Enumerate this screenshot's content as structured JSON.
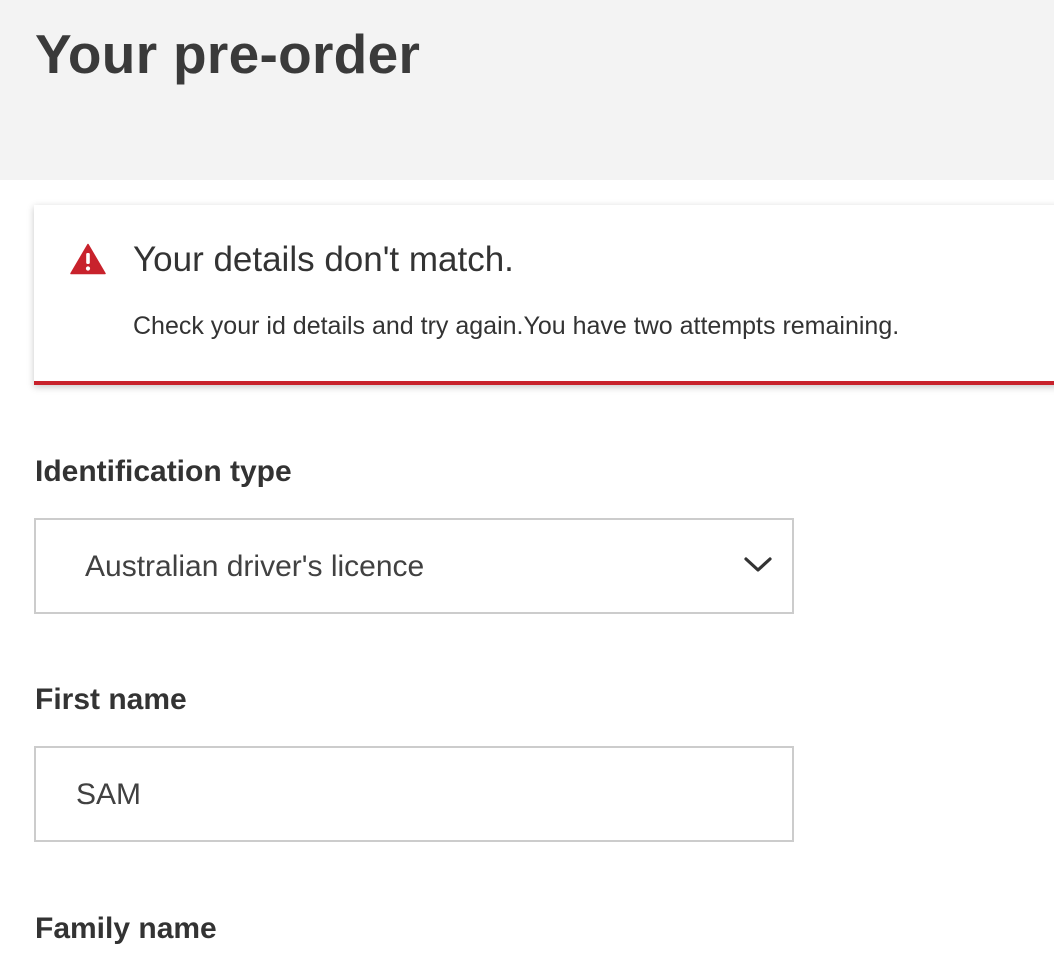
{
  "header": {
    "title": "Your pre-order"
  },
  "alert": {
    "icon": "warning-triangle-icon",
    "title": "Your details don't match.",
    "message": "Check your id details and try again.You have two attempts remaining.",
    "accent_color": "#c8222c"
  },
  "form": {
    "identification_type": {
      "label": "Identification type",
      "selected_value": "Australian driver's licence",
      "icon": "chevron-down-icon"
    },
    "first_name": {
      "label": "First name",
      "value": "SAM"
    },
    "family_name": {
      "label": "Family name"
    }
  },
  "colors": {
    "header_background": "#f3f3f3",
    "text": "#333333",
    "field_border": "#cccccc",
    "error": "#c8222c"
  }
}
